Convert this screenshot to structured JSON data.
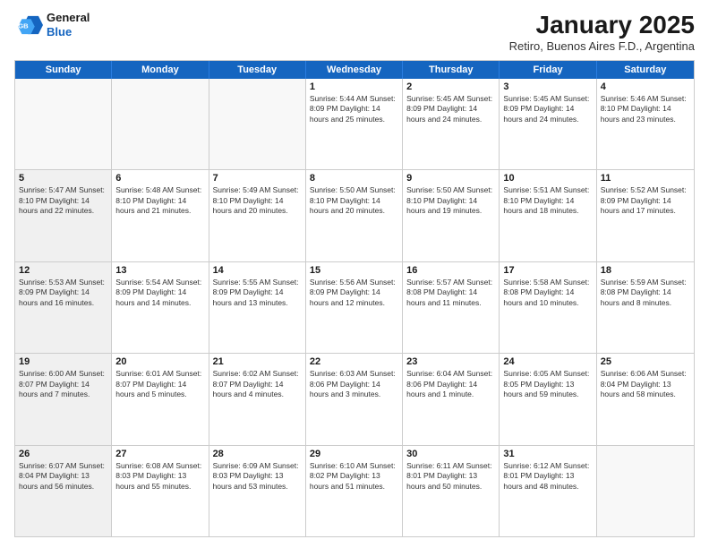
{
  "header": {
    "logo_line1": "General",
    "logo_line2": "Blue",
    "month": "January 2025",
    "location": "Retiro, Buenos Aires F.D., Argentina"
  },
  "days_of_week": [
    "Sunday",
    "Monday",
    "Tuesday",
    "Wednesday",
    "Thursday",
    "Friday",
    "Saturday"
  ],
  "weeks": [
    [
      {
        "day": "",
        "info": "",
        "shaded": true
      },
      {
        "day": "",
        "info": "",
        "shaded": true
      },
      {
        "day": "",
        "info": "",
        "shaded": true
      },
      {
        "day": "1",
        "info": "Sunrise: 5:44 AM\nSunset: 8:09 PM\nDaylight: 14 hours\nand 25 minutes.",
        "shaded": false
      },
      {
        "day": "2",
        "info": "Sunrise: 5:45 AM\nSunset: 8:09 PM\nDaylight: 14 hours\nand 24 minutes.",
        "shaded": false
      },
      {
        "day": "3",
        "info": "Sunrise: 5:45 AM\nSunset: 8:09 PM\nDaylight: 14 hours\nand 24 minutes.",
        "shaded": false
      },
      {
        "day": "4",
        "info": "Sunrise: 5:46 AM\nSunset: 8:10 PM\nDaylight: 14 hours\nand 23 minutes.",
        "shaded": false
      }
    ],
    [
      {
        "day": "5",
        "info": "Sunrise: 5:47 AM\nSunset: 8:10 PM\nDaylight: 14 hours\nand 22 minutes.",
        "shaded": true
      },
      {
        "day": "6",
        "info": "Sunrise: 5:48 AM\nSunset: 8:10 PM\nDaylight: 14 hours\nand 21 minutes.",
        "shaded": false
      },
      {
        "day": "7",
        "info": "Sunrise: 5:49 AM\nSunset: 8:10 PM\nDaylight: 14 hours\nand 20 minutes.",
        "shaded": false
      },
      {
        "day": "8",
        "info": "Sunrise: 5:50 AM\nSunset: 8:10 PM\nDaylight: 14 hours\nand 20 minutes.",
        "shaded": false
      },
      {
        "day": "9",
        "info": "Sunrise: 5:50 AM\nSunset: 8:10 PM\nDaylight: 14 hours\nand 19 minutes.",
        "shaded": false
      },
      {
        "day": "10",
        "info": "Sunrise: 5:51 AM\nSunset: 8:10 PM\nDaylight: 14 hours\nand 18 minutes.",
        "shaded": false
      },
      {
        "day": "11",
        "info": "Sunrise: 5:52 AM\nSunset: 8:09 PM\nDaylight: 14 hours\nand 17 minutes.",
        "shaded": false
      }
    ],
    [
      {
        "day": "12",
        "info": "Sunrise: 5:53 AM\nSunset: 8:09 PM\nDaylight: 14 hours\nand 16 minutes.",
        "shaded": true
      },
      {
        "day": "13",
        "info": "Sunrise: 5:54 AM\nSunset: 8:09 PM\nDaylight: 14 hours\nand 14 minutes.",
        "shaded": false
      },
      {
        "day": "14",
        "info": "Sunrise: 5:55 AM\nSunset: 8:09 PM\nDaylight: 14 hours\nand 13 minutes.",
        "shaded": false
      },
      {
        "day": "15",
        "info": "Sunrise: 5:56 AM\nSunset: 8:09 PM\nDaylight: 14 hours\nand 12 minutes.",
        "shaded": false
      },
      {
        "day": "16",
        "info": "Sunrise: 5:57 AM\nSunset: 8:08 PM\nDaylight: 14 hours\nand 11 minutes.",
        "shaded": false
      },
      {
        "day": "17",
        "info": "Sunrise: 5:58 AM\nSunset: 8:08 PM\nDaylight: 14 hours\nand 10 minutes.",
        "shaded": false
      },
      {
        "day": "18",
        "info": "Sunrise: 5:59 AM\nSunset: 8:08 PM\nDaylight: 14 hours\nand 8 minutes.",
        "shaded": false
      }
    ],
    [
      {
        "day": "19",
        "info": "Sunrise: 6:00 AM\nSunset: 8:07 PM\nDaylight: 14 hours\nand 7 minutes.",
        "shaded": true
      },
      {
        "day": "20",
        "info": "Sunrise: 6:01 AM\nSunset: 8:07 PM\nDaylight: 14 hours\nand 5 minutes.",
        "shaded": false
      },
      {
        "day": "21",
        "info": "Sunrise: 6:02 AM\nSunset: 8:07 PM\nDaylight: 14 hours\nand 4 minutes.",
        "shaded": false
      },
      {
        "day": "22",
        "info": "Sunrise: 6:03 AM\nSunset: 8:06 PM\nDaylight: 14 hours\nand 3 minutes.",
        "shaded": false
      },
      {
        "day": "23",
        "info": "Sunrise: 6:04 AM\nSunset: 8:06 PM\nDaylight: 14 hours\nand 1 minute.",
        "shaded": false
      },
      {
        "day": "24",
        "info": "Sunrise: 6:05 AM\nSunset: 8:05 PM\nDaylight: 13 hours\nand 59 minutes.",
        "shaded": false
      },
      {
        "day": "25",
        "info": "Sunrise: 6:06 AM\nSunset: 8:04 PM\nDaylight: 13 hours\nand 58 minutes.",
        "shaded": false
      }
    ],
    [
      {
        "day": "26",
        "info": "Sunrise: 6:07 AM\nSunset: 8:04 PM\nDaylight: 13 hours\nand 56 minutes.",
        "shaded": true
      },
      {
        "day": "27",
        "info": "Sunrise: 6:08 AM\nSunset: 8:03 PM\nDaylight: 13 hours\nand 55 minutes.",
        "shaded": false
      },
      {
        "day": "28",
        "info": "Sunrise: 6:09 AM\nSunset: 8:03 PM\nDaylight: 13 hours\nand 53 minutes.",
        "shaded": false
      },
      {
        "day": "29",
        "info": "Sunrise: 6:10 AM\nSunset: 8:02 PM\nDaylight: 13 hours\nand 51 minutes.",
        "shaded": false
      },
      {
        "day": "30",
        "info": "Sunrise: 6:11 AM\nSunset: 8:01 PM\nDaylight: 13 hours\nand 50 minutes.",
        "shaded": false
      },
      {
        "day": "31",
        "info": "Sunrise: 6:12 AM\nSunset: 8:01 PM\nDaylight: 13 hours\nand 48 minutes.",
        "shaded": false
      },
      {
        "day": "",
        "info": "",
        "shaded": true
      }
    ]
  ]
}
